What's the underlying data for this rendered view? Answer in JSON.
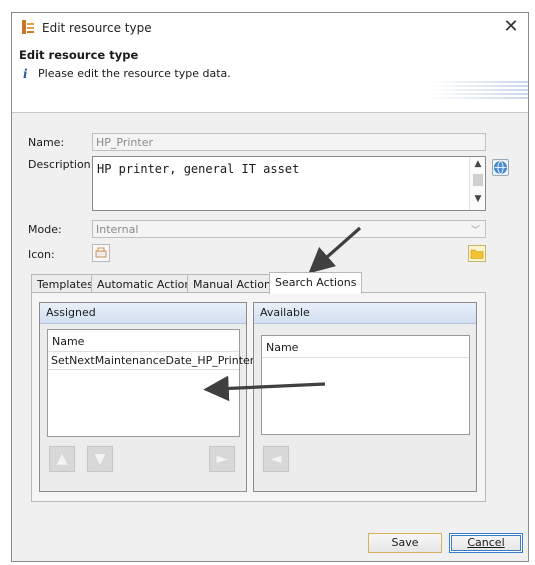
{
  "window": {
    "title": "Edit resource type",
    "close_glyph": "✕"
  },
  "header": {
    "title": "Edit resource type",
    "info_glyph": "i",
    "message": "Please edit the resource type data."
  },
  "form": {
    "name_label": "Name:",
    "name_value": "HP_Printer",
    "description_label": "Description:",
    "description_value": "HP printer, general IT asset",
    "mode_label": "Mode:",
    "mode_value": "Internal",
    "icon_label": "Icon:"
  },
  "tabs": [
    {
      "label": "Templates",
      "active": false
    },
    {
      "label": "Automatic Actions",
      "active": false
    },
    {
      "label": "Manual Actions",
      "active": false
    },
    {
      "label": "Search Actions",
      "active": true
    }
  ],
  "assigned": {
    "title": "Assigned",
    "column": "Name",
    "rows": [
      "SetNextMaintenanceDate_HP_Printers"
    ]
  },
  "available": {
    "title": "Available",
    "column": "Name",
    "rows": []
  },
  "buttons": {
    "save": "Save",
    "cancel": "Cancel"
  },
  "icons": {
    "app": "resource-type-icon",
    "info": "info-icon",
    "globe": "globe-icon",
    "folder": "folder-icon",
    "move_up": "arrow-up-icon",
    "move_down": "arrow-down-icon",
    "move_right": "arrow-right-icon",
    "move_left": "arrow-left-icon"
  },
  "colors": {
    "accent": "#3a7dc8",
    "group_header": "#d2dff0",
    "annotation_arrow": "#404040"
  }
}
